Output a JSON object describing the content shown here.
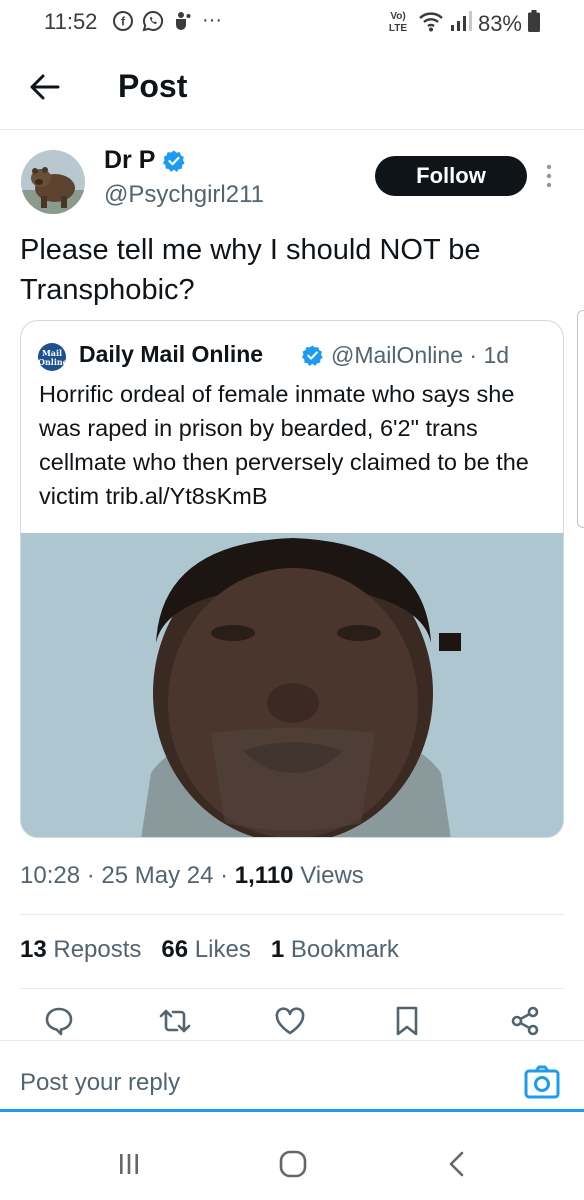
{
  "status_bar": {
    "time": "11:52",
    "battery": "83%",
    "network": "Vo) LTE",
    "more": "···"
  },
  "header": {
    "title": "Post"
  },
  "post": {
    "author_name": "Dr P",
    "author_handle": "@Psychgirl211",
    "follow_label": "Follow",
    "text": "Please tell me why I should NOT be Transphobic?",
    "timestamp": "10:28 · 25 May 24 · ",
    "views_count": "1,110",
    "views_label": "Views",
    "stats": {
      "reposts_count": "13",
      "reposts_label": "Reposts",
      "likes_count": "66",
      "likes_label": "Likes",
      "bookmarks_count": "1",
      "bookmarks_label": "Bookmark"
    }
  },
  "quote": {
    "logo_text": "Mail Online",
    "name": "Daily Mail Online",
    "handle_time": "@MailOnline · 1d",
    "text": "Horrific ordeal of female inmate who says she was raped in prison by bearded, 6'2\" trans cellmate who then perversely claimed to be the victim trib.al/Yt8sKmB"
  },
  "reply": {
    "placeholder": "Post your reply"
  },
  "colors": {
    "accent": "#1d9bf0",
    "text_primary": "#0f1419",
    "text_secondary": "#536471",
    "border": "#cfd9de",
    "follow_bg": "#0f1419"
  },
  "icons": {
    "back": "arrow-left-icon",
    "verified": "verified-badge-icon",
    "more": "more-vertical-icon",
    "reply": "reply-icon",
    "repost": "repost-icon",
    "like": "heart-icon",
    "bookmark": "bookmark-icon",
    "share": "share-icon",
    "camera": "camera-icon"
  }
}
